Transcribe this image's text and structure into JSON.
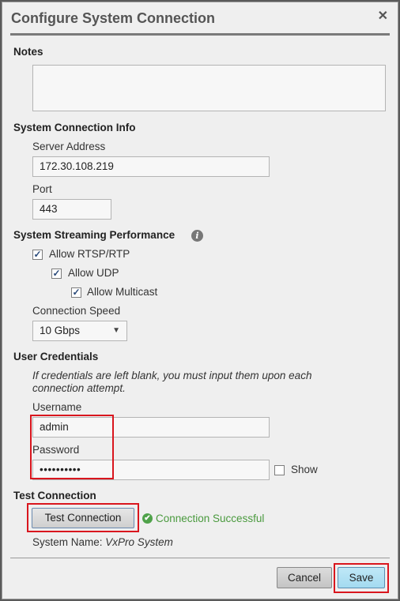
{
  "dialog": {
    "title": "Configure System Connection",
    "close_glyph": "✕"
  },
  "notes": {
    "heading": "Notes",
    "value": ""
  },
  "connection_info": {
    "heading": "System Connection Info",
    "server_label": "Server Address",
    "server_value": "172.30.108.219",
    "port_label": "Port",
    "port_value": "443"
  },
  "streaming": {
    "heading": "System Streaming Performance",
    "info_icon": "i",
    "allow_rtsp": {
      "label": "Allow RTSP/RTP",
      "checked": true
    },
    "allow_udp": {
      "label": "Allow UDP",
      "checked": true
    },
    "allow_multicast": {
      "label": "Allow Multicast",
      "checked": true
    },
    "speed_label": "Connection Speed",
    "speed_value": "10 Gbps",
    "speed_arrow": "▼"
  },
  "credentials": {
    "heading": "User Credentials",
    "note_line1": "If credentials are left blank, you must input them upon each",
    "note_line2": "connection attempt.",
    "username_label": "Username",
    "username_value": "admin",
    "password_label": "Password",
    "password_value": "••••••••••",
    "show_label": "Show",
    "show_checked": false
  },
  "test": {
    "heading": "Test Connection",
    "button_label": "Test Connection",
    "status_text": "Connection Successful",
    "status_icon": "✔",
    "system_name_label": "System Name:",
    "system_name_value": "VxPro System"
  },
  "footer": {
    "cancel_label": "Cancel",
    "save_label": "Save"
  },
  "colors": {
    "highlight": "#d9161e",
    "success": "#4a9a3e",
    "save_button": "#a3daf0"
  }
}
